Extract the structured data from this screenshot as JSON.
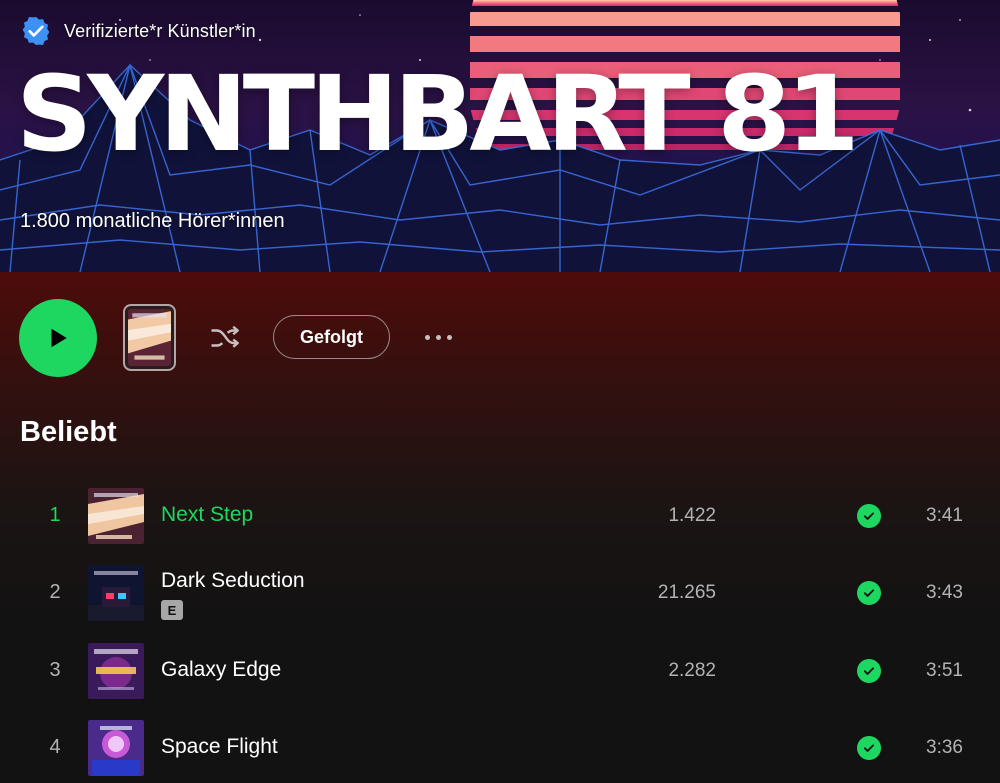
{
  "hero": {
    "verified_label": "Verifizierte*r Künstler*in",
    "artist_name": "SYNTHBART 81",
    "monthly_listeners": "1.800 monatliche Hörer*innen"
  },
  "actions": {
    "follow_label": "Gefolgt"
  },
  "popular": {
    "section_title": "Beliebt",
    "tracks": [
      {
        "number": "1",
        "title": "Next Step",
        "explicit": false,
        "plays": "1.422",
        "duration": "3:41",
        "active": true
      },
      {
        "number": "2",
        "title": "Dark Seduction",
        "explicit": true,
        "explicit_label": "E",
        "plays": "21.265",
        "duration": "3:43",
        "active": false
      },
      {
        "number": "3",
        "title": "Galaxy Edge",
        "explicit": false,
        "plays": "2.282",
        "duration": "3:51",
        "active": false
      },
      {
        "number": "4",
        "title": "Space Flight",
        "explicit": false,
        "plays": "",
        "duration": "3:36",
        "active": false
      }
    ]
  },
  "colors": {
    "accent_green": "#1ed760",
    "verified_blue": "#3d91f4",
    "header_red": "#4e0b0a",
    "background": "#121212"
  },
  "icons": {
    "verified": "verified-badge-icon",
    "play": "play-icon",
    "shuffle": "shuffle-icon",
    "more": "more-horizontal-icon",
    "saved": "check-circle-icon"
  }
}
